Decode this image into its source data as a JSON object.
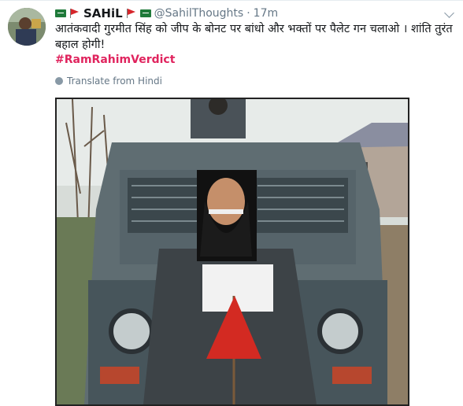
{
  "tweet": {
    "display_name": "SAHiL",
    "handle": "@SahilThoughts",
    "separator": "·",
    "time": "17m",
    "text": "आतंकवादी गुरमीत सिंह को जीप के बोनट पर बांधो और भक्तों पर पैलेट गन चलाओ । शांति तुरंत बहाल होगी!",
    "hashtag": "#RamRahimVerdict",
    "translate_label": "Translate from Hindi"
  },
  "icons": {
    "name_prefix": [
      "saudi-flag-icon",
      "red-flag-icon"
    ],
    "name_suffix": [
      "red-flag-icon",
      "saudi-flag-icon"
    ],
    "menu": "chevron-down-icon",
    "translate": "globe-icon"
  },
  "colors": {
    "hashtag": "#e0245e",
    "secondary_text": "#657786",
    "flag_green": "#1f7a3a",
    "flag_red": "#d6262b"
  }
}
